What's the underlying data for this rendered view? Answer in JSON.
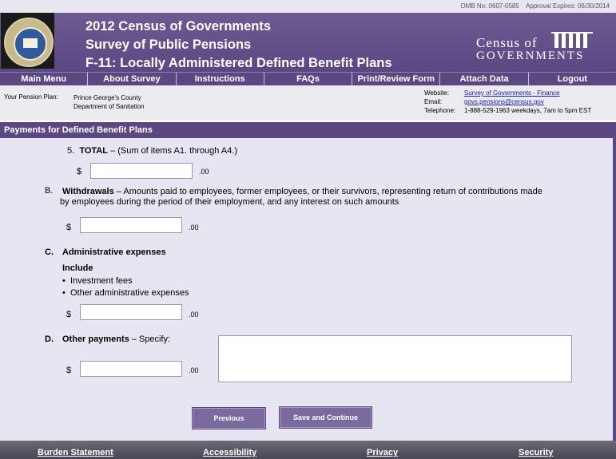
{
  "omb": {
    "number": "OMB No:  0607-0585",
    "approval": "Approval Expires:  06/30/2014"
  },
  "header": {
    "title1": "2012 Census of Governments",
    "title2": "Survey of Public Pensions",
    "title3": "F-11:  Locally Administered Defined Benefit Plans",
    "logo_line1": "Census of",
    "logo_line2": "GOVERNMENTS",
    "seal_text": "U.S. DEPARTMENT OF COMMERCE · BUREAU OF THE CENSUS"
  },
  "nav": [
    "Main Menu",
    "About Survey",
    "Instructions",
    "FAQs",
    "Print/Review Form",
    "Attach Data",
    "Logout"
  ],
  "info": {
    "plan_label": "Your Pension Plan:",
    "plan_line1": "Prince George's County",
    "plan_line2": "Department of Sanitation",
    "website_label": "Website:",
    "website_value": "Survey of Governments - Finance",
    "email_label": "Email:",
    "email_value": "govs.pensions@census.gov",
    "telephone_label": "Telephone:",
    "telephone_value": "1-888-529-1963  weekdays, 7am to 5pm EST"
  },
  "section_title": "Payments for Defined Benefit Plans",
  "items": {
    "total": {
      "number": "5.",
      "bold": "TOTAL",
      "text": " – (Sum of items A1. through A4.)"
    },
    "b": {
      "letter": "B.",
      "bold": "Withdrawals",
      "text": " – Amounts paid to employees, former employees, or their survivors, representing return of contributions made",
      "text2": "by employees during the period of their employment, and any interest on such amounts"
    },
    "c": {
      "letter": "C.",
      "bold": "Administrative expenses",
      "include": "Include",
      "bullet1": "Investment fees",
      "bullet2": "Other administrative expenses"
    },
    "d": {
      "letter": "D.",
      "bold": "Other payments",
      "text": " – Specify:"
    }
  },
  "currency": "$",
  "cents": ".00",
  "buttons": {
    "previous": "Previous",
    "save": "Save and Continue"
  },
  "footer": [
    "Burden Statement",
    "Accessibility",
    "Privacy",
    "Security"
  ]
}
